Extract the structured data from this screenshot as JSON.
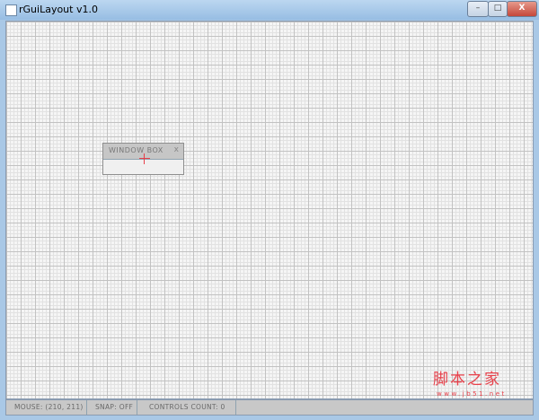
{
  "window": {
    "title": "rGuiLayout v1.0",
    "minimize": "–",
    "maximize": "□",
    "close": "X"
  },
  "window_box": {
    "title": "WINDOW BOX",
    "close": "x"
  },
  "status": {
    "mouse": "MOUSE: (210, 211)",
    "snap": "SNAP: OFF",
    "controls": "CONTROLS COUNT: 0"
  },
  "watermark": {
    "line1": "脚本之家",
    "line2": "www.jb51.net"
  }
}
